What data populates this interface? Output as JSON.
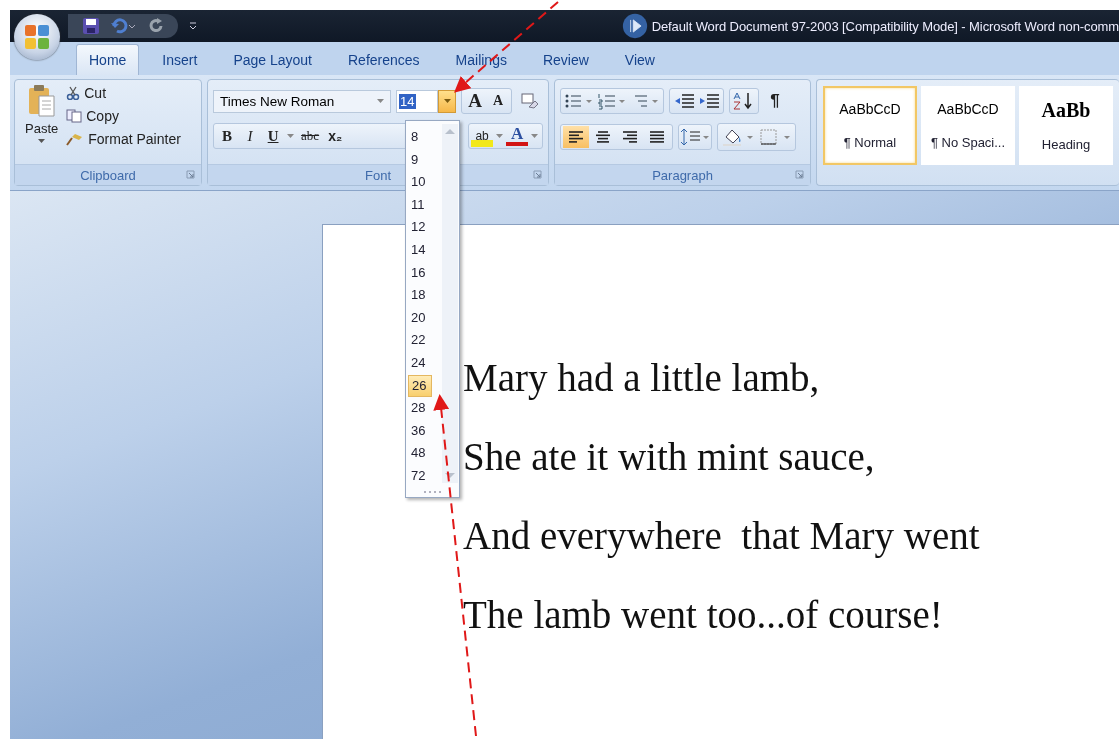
{
  "window": {
    "title": "Default Word Document 97-2003 [Compatibility Mode] - Microsoft Word non-comm"
  },
  "tabs": [
    {
      "label": "Home",
      "selected": true
    },
    {
      "label": "Insert",
      "selected": false
    },
    {
      "label": "Page Layout",
      "selected": false
    },
    {
      "label": "References",
      "selected": false
    },
    {
      "label": "Mailings",
      "selected": false
    },
    {
      "label": "Review",
      "selected": false
    },
    {
      "label": "View",
      "selected": false
    }
  ],
  "clipboard": {
    "paste": "Paste",
    "cut": "Cut",
    "copy": "Copy",
    "format_painter": "Format Painter",
    "label": "Clipboard"
  },
  "font": {
    "family": "Times New Roman",
    "size": "14",
    "grow": "A",
    "shrink": "A",
    "bold": "B",
    "italic": "I",
    "underline": "U",
    "strike": "abc",
    "subscript": "x₂",
    "highlight": "ab",
    "font_color": "A",
    "label": "Font"
  },
  "size_menu": [
    {
      "label": "8",
      "selected": false
    },
    {
      "label": "9",
      "selected": false
    },
    {
      "label": "10",
      "selected": false
    },
    {
      "label": "11",
      "selected": false
    },
    {
      "label": "12",
      "selected": false
    },
    {
      "label": "14",
      "selected": false
    },
    {
      "label": "16",
      "selected": false
    },
    {
      "label": "18",
      "selected": false
    },
    {
      "label": "20",
      "selected": false
    },
    {
      "label": "22",
      "selected": false
    },
    {
      "label": "24",
      "selected": false
    },
    {
      "label": "26",
      "selected": true
    },
    {
      "label": "28",
      "selected": false
    },
    {
      "label": "36",
      "selected": false
    },
    {
      "label": "48",
      "selected": false
    },
    {
      "label": "72",
      "selected": false
    }
  ],
  "paragraph": {
    "label": "Paragraph",
    "pilcrow": "¶",
    "alignment": [
      {
        "selected": true
      },
      {
        "selected": false
      },
      {
        "selected": false
      },
      {
        "selected": false
      }
    ]
  },
  "styles": [
    {
      "kind": "body",
      "preview": "AaBbCcD",
      "name": "¶ Normal",
      "selected": true
    },
    {
      "kind": "body",
      "preview": "AaBbCcD",
      "name": "¶ No Spaci...",
      "selected": false
    },
    {
      "kind": "heading",
      "preview": "AaBb",
      "name": "Heading",
      "selected": false
    }
  ],
  "document": {
    "lines": [
      "Mary had a little lamb,",
      "She ate it with mint sauce,",
      "And everywhere  that Mary went",
      "The lamb went too...of course!"
    ]
  }
}
